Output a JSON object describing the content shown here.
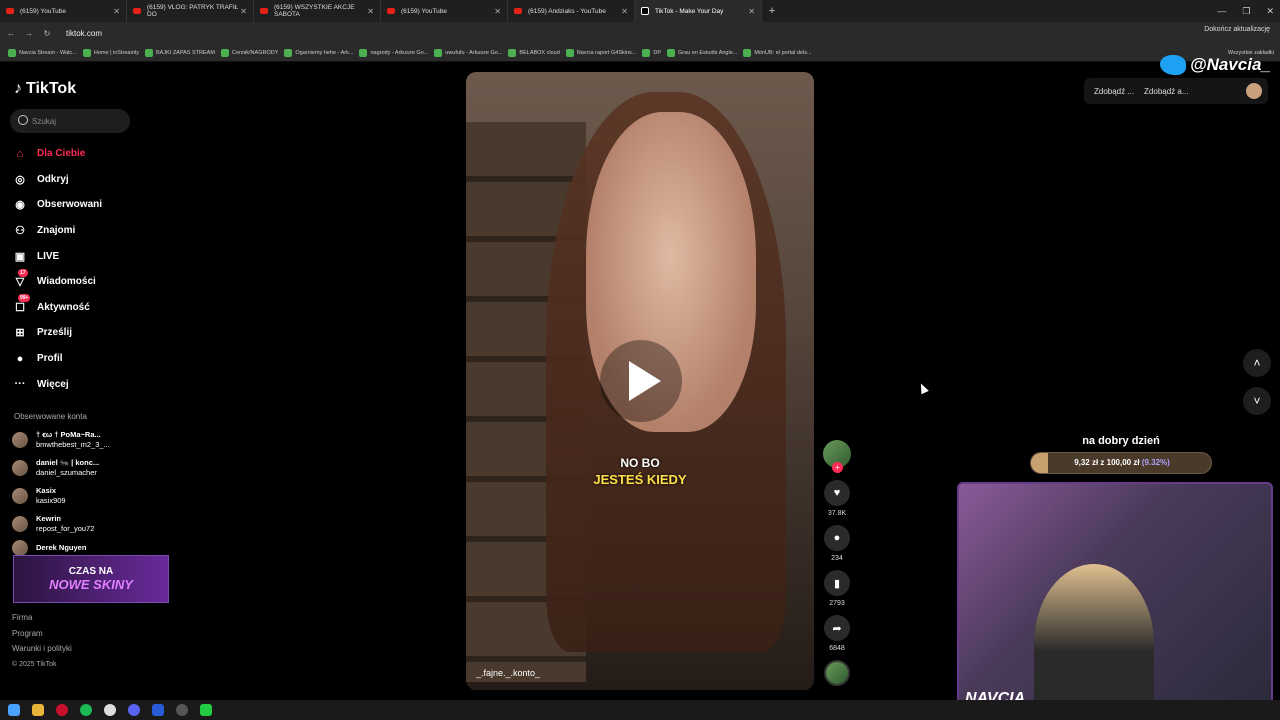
{
  "browser": {
    "tabs": [
      {
        "title": "(6159) YouTube",
        "icon": "youtube-icon",
        "active": false
      },
      {
        "title": "(6159) VLOG: PATRYK TRAFIŁ DO",
        "icon": "youtube-icon",
        "active": false
      },
      {
        "title": "(6159) WSZYSTKIE AKCJE SABOTA",
        "icon": "youtube-icon",
        "active": false
      },
      {
        "title": "(6159) YouTube",
        "icon": "youtube-icon",
        "active": false
      },
      {
        "title": "(6159) Andziaks - YouTube",
        "icon": "youtube-icon",
        "active": false
      },
      {
        "title": "TikTok - Make Your Day",
        "icon": "tiktok-icon",
        "active": true
      }
    ],
    "url": "tiktok.com",
    "update_label": "Dokończ aktualizację",
    "bookmarks": [
      "Navcia Stream - Watc...",
      "Home | inStreamly",
      "BAJKI ZAPAS STREAM",
      "Cennik/NAGRODY",
      "Ogarniemy hehe - Ark...",
      "nagrody - Arkusze Go...",
      "uwufufu - Arkusze Go...",
      "BELABOX cloud",
      "Navcia raport G4Skins...",
      "DP",
      "Grau en Estudis Angle...",
      "MónUB: el portal dels..."
    ],
    "all_bookmarks": "Wszystkie zakładki"
  },
  "tiktok": {
    "brand": "TikTok",
    "search_placeholder": "Szukaj",
    "menu": [
      {
        "label": "Dla Ciebie",
        "icon": "home-icon",
        "active": true
      },
      {
        "label": "Odkryj",
        "icon": "compass-icon"
      },
      {
        "label": "Obserwowani",
        "icon": "following-icon"
      },
      {
        "label": "Znajomi",
        "icon": "friends-icon"
      },
      {
        "label": "LIVE",
        "icon": "live-icon"
      },
      {
        "label": "Wiadomości",
        "icon": "messages-icon",
        "badge": "17"
      },
      {
        "label": "Aktywność",
        "icon": "activity-icon",
        "badge": "99+"
      },
      {
        "label": "Prześlij",
        "icon": "upload-icon"
      },
      {
        "label": "Profil",
        "icon": "profile-icon"
      },
      {
        "label": "Więcej",
        "icon": "more-icon"
      }
    ],
    "followed_header": "Obserwowane konta",
    "followed": [
      {
        "name": "† ꞓω † PoMa~Ra...",
        "handle": "bmwthebest_m2_3_..."
      },
      {
        "name": "daniel 🐜 | konc...",
        "handle": "daniel_szumacher"
      },
      {
        "name": "Kasix",
        "handle": "kasix909"
      },
      {
        "name": "Kewrin",
        "handle": "repost_for_you72"
      },
      {
        "name": "Derek Nguyen",
        "handle": ""
      }
    ],
    "promo": {
      "line1": "CZAS NA",
      "line2": "NOWE SKINY"
    },
    "footer": [
      "Firma",
      "Program",
      "Warunki i polityki"
    ],
    "copyright": "© 2025 TikTok",
    "video": {
      "caption_line1": "NO BO",
      "caption_line2": "JESTEŚ KIEDY",
      "author": "_.fajne._.konto_"
    },
    "actions": [
      {
        "icon": "heart-icon",
        "count": "37.8K"
      },
      {
        "icon": "comment-icon",
        "count": "234"
      },
      {
        "icon": "bookmark-icon",
        "count": "2793"
      },
      {
        "icon": "share-icon",
        "count": "6848"
      }
    ],
    "top_buttons": [
      "Zdobądź ...",
      "Zdobądź a..."
    ]
  },
  "overlay": {
    "twitter_handle": "@Navcia_",
    "goal_title": "na dobry dzień",
    "goal_text": "9,32 zł z 100,00 zł",
    "goal_pct": "(9.32%)",
    "goal_fraction": 0.0932,
    "streamer_name": "NAVCIA"
  }
}
